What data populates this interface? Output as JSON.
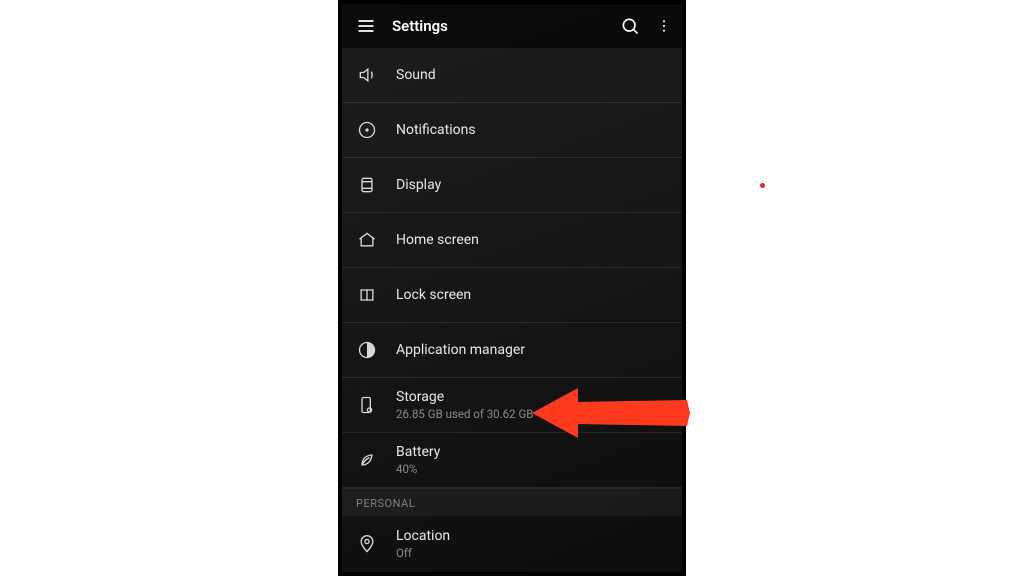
{
  "header": {
    "title": "Settings"
  },
  "items": [
    {
      "id": "sound",
      "label": "Sound"
    },
    {
      "id": "notifications",
      "label": "Notifications"
    },
    {
      "id": "display",
      "label": "Display"
    },
    {
      "id": "home",
      "label": "Home screen"
    },
    {
      "id": "lock",
      "label": "Lock screen"
    },
    {
      "id": "apps",
      "label": "Application manager"
    },
    {
      "id": "storage",
      "label": "Storage",
      "sub": "26.85 GB used of 30.62 GB"
    },
    {
      "id": "battery",
      "label": "Battery",
      "sub": "40%"
    }
  ],
  "section": {
    "personal": "PERSONAL"
  },
  "personal_items": [
    {
      "id": "location",
      "label": "Location",
      "sub": "Off"
    }
  ],
  "annotation": {
    "arrow_color": "#ff3b1f"
  }
}
